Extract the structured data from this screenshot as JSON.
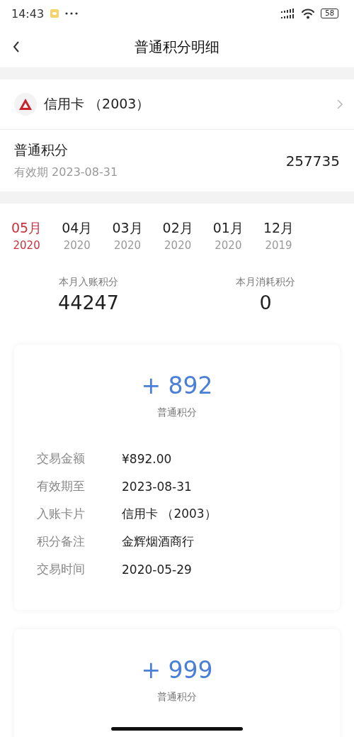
{
  "status_bar": {
    "time": "14:43",
    "battery": "58"
  },
  "nav": {
    "title": "普通积分明细"
  },
  "account": {
    "card_name": "信用卡 （2003）"
  },
  "points": {
    "label": "普通积分",
    "expiry": "有效期 2023-08-31",
    "value": "257735"
  },
  "months": [
    {
      "month": "05月",
      "year": "2020",
      "selected": true
    },
    {
      "month": "04月",
      "year": "2020",
      "selected": false
    },
    {
      "month": "03月",
      "year": "2020",
      "selected": false
    },
    {
      "month": "02月",
      "year": "2020",
      "selected": false
    },
    {
      "month": "01月",
      "year": "2020",
      "selected": false
    },
    {
      "month": "12月",
      "year": "2019",
      "selected": false
    }
  ],
  "summary": [
    {
      "label": "本月入账积分",
      "value": "44247"
    },
    {
      "label": "本月消耗积分",
      "value": "0"
    }
  ],
  "records": [
    {
      "amount": "+ 892",
      "type": "普通积分",
      "details": [
        {
          "label": "交易金额",
          "value": "¥892.00"
        },
        {
          "label": "有效期至",
          "value": "2023-08-31"
        },
        {
          "label": "入账卡片",
          "value": "信用卡 （2003）"
        },
        {
          "label": "积分备注",
          "value": "金辉烟酒商行"
        },
        {
          "label": "交易时间",
          "value": "2020-05-29"
        }
      ]
    },
    {
      "amount": "+ 999",
      "type": "普通积分"
    }
  ]
}
